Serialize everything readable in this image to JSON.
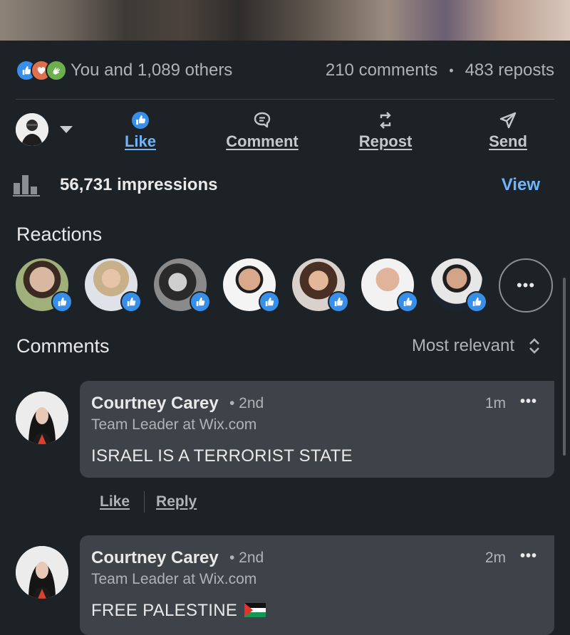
{
  "stats": {
    "reactions_text": "You and 1,089 others",
    "comments_text": "210 comments",
    "reposts_text": "483 reposts"
  },
  "actions": {
    "like": "Like",
    "comment": "Comment",
    "repost": "Repost",
    "send": "Send"
  },
  "impressions": {
    "text": "56,731 impressions",
    "view_label": "View"
  },
  "reactions_section": {
    "title": "Reactions",
    "more_label": "•••"
  },
  "comments_section": {
    "title": "Comments",
    "sort_label": "Most relevant"
  },
  "comments": [
    {
      "author": "Courtney Carey",
      "degree": "• 2nd",
      "headline": "Team Leader at Wix.com",
      "time": "1m",
      "text": "ISRAEL IS A TERRORIST STATE",
      "like_label": "Like",
      "reply_label": "Reply"
    },
    {
      "author": "Courtney Carey",
      "degree": "• 2nd",
      "headline": "Team Leader at Wix.com",
      "time": "2m",
      "text": "FREE PALESTINE"
    }
  ],
  "menu_label": "•••",
  "colors": {
    "background": "#1d2226",
    "accent_blue": "#70b5f9",
    "like_blue": "#378fe9",
    "bubble": "#3e4349"
  }
}
